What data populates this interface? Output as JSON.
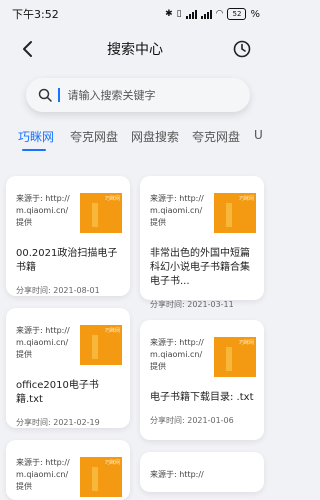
{
  "status_bar": {
    "time": "下午3:52",
    "battery": "52",
    "battery_percent": "%"
  },
  "header": {
    "title": "搜索中心"
  },
  "search": {
    "placeholder": "请输入搜索关键字"
  },
  "tabs": [
    {
      "label": "巧眯网",
      "active": true
    },
    {
      "label": "夸克网盘"
    },
    {
      "label": "网盘搜索"
    },
    {
      "label": "夸克网盘"
    },
    {
      "label": "U"
    }
  ],
  "cards": [
    {
      "source": "来源于: http://m.qiaomi.cn/提供",
      "title": "00.2021政治扫描电子书籍",
      "share_time": "分享时间: 2021-08-01"
    },
    {
      "source": "来源于: http://m.qiaomi.cn/提供",
      "title": "非常出色的外国中短篇科幻小说电子书籍合集电子书...",
      "share_time": "分享时间: 2021-03-11"
    },
    {
      "source": "来源于: http://m.qiaomi.cn/提供",
      "title": "office2010电子书籍.txt",
      "share_time": "分享时间: 2021-02-19"
    },
    {
      "source": "来源于: http://m.qiaomi.cn/提供",
      "title": "电子书籍下载目录: .txt",
      "share_time": "分享时间: 2021-01-06"
    },
    {
      "source": "来源于: http://m.qiaomi.cn/提供"
    },
    {
      "source": "来源于: http://"
    }
  ],
  "colors": {
    "accent": "#1a73ff",
    "thumbnail": "#f39a12",
    "background": "#f1f2f6"
  },
  "icons": {
    "back": "back-arrow-icon",
    "history": "history-clock-icon",
    "search": "search-icon"
  }
}
